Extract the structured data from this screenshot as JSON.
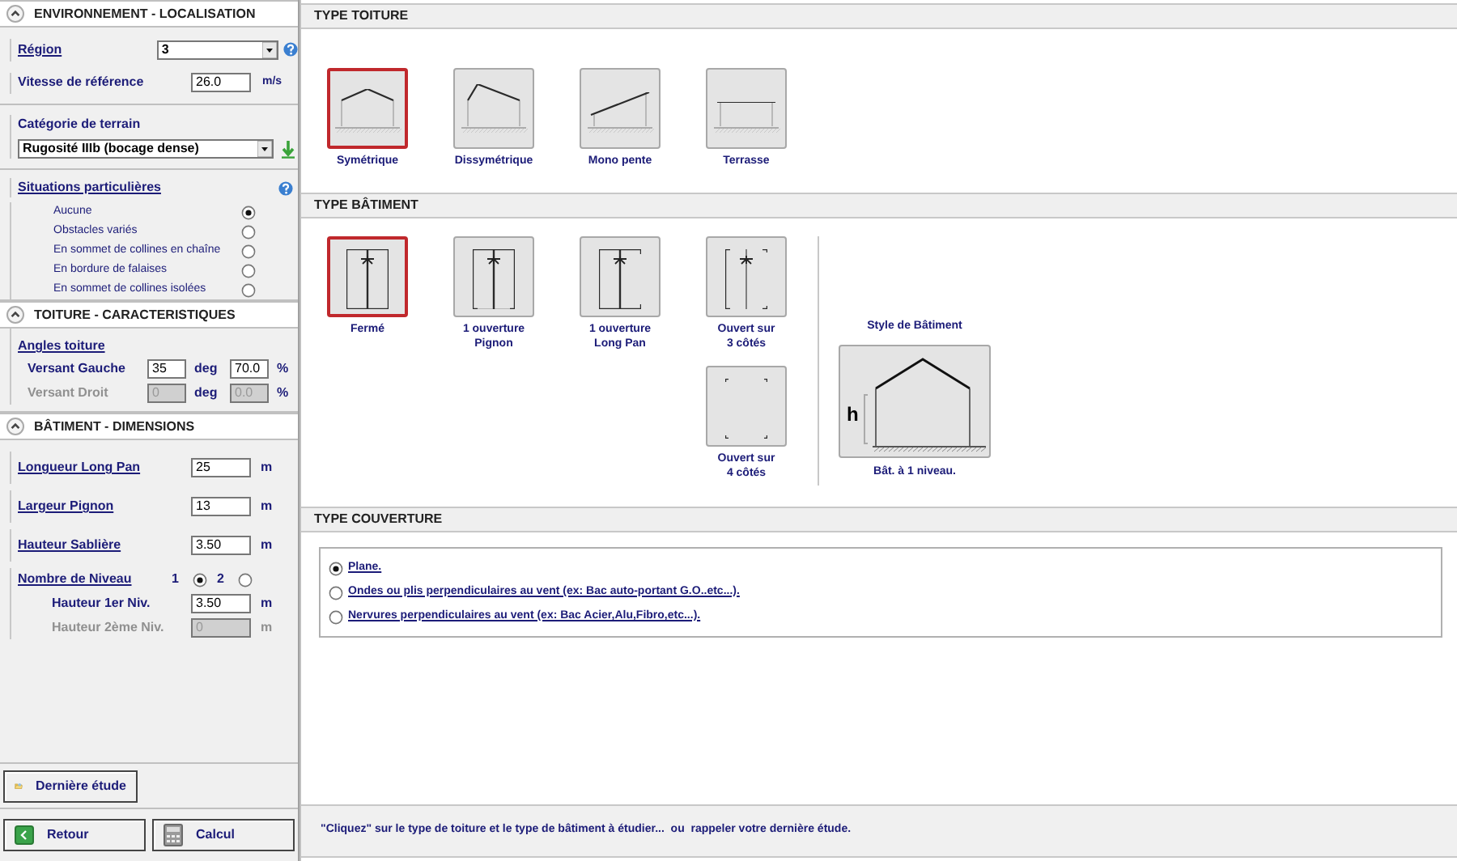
{
  "environnement": {
    "title": "ENVIRONNEMENT - LOCALISATION",
    "expanded": true,
    "region": {
      "label": "Région",
      "value": "3"
    },
    "vitesse": {
      "label": "Vitesse de référence",
      "value": "26.0",
      "unit": "m/s"
    },
    "terrain": {
      "label": "Catégorie de terrain",
      "value": "Rugosité IIIb (bocage dense)"
    },
    "situations": {
      "label": "Situations particulières",
      "options": [
        {
          "label": "Aucune",
          "selected": true
        },
        {
          "label": "Obstacles variés",
          "selected": false
        },
        {
          "label": "En sommet de collines en chaîne",
          "selected": false
        },
        {
          "label": "En bordure de falaises",
          "selected": false
        },
        {
          "label": "En sommet de collines isolées",
          "selected": false
        }
      ]
    }
  },
  "toiture": {
    "title": "TOITURE - CARACTERISTIQUES",
    "expanded": true,
    "angles_label": "Angles toiture",
    "rows": [
      {
        "label": "Versant Gauche",
        "deg": "35",
        "deg_unit": "deg",
        "pct": "70.0",
        "pct_unit": "%",
        "disabled": false
      },
      {
        "label": "Versant Droit",
        "deg": "0",
        "deg_unit": "deg",
        "pct": "0.0",
        "pct_unit": "%",
        "disabled": true
      }
    ]
  },
  "batiment": {
    "title": "BÂTIMENT - DIMENSIONS",
    "expanded": true,
    "fields": [
      {
        "label": "Longueur Long Pan",
        "value": "25",
        "unit": "m"
      },
      {
        "label": "Largeur Pignon",
        "value": "13",
        "unit": "m"
      },
      {
        "label": "Hauteur Sablière",
        "value": "3.50",
        "unit": "m"
      }
    ],
    "niveaux": {
      "label": "Nombre de Niveau",
      "options": [
        {
          "label": "1",
          "selected": true
        },
        {
          "label": "2",
          "selected": false
        }
      ]
    },
    "hauteurs": [
      {
        "label": "Hauteur 1er Niv.",
        "value": "3.50",
        "unit": "m",
        "disabled": false
      },
      {
        "label": "Hauteur 2ème Niv.",
        "value": "0",
        "unit": "m",
        "disabled": true
      }
    ]
  },
  "buttons": [
    {
      "kind": "derniere",
      "label": "Dernière étude"
    },
    {
      "kind": "retour",
      "label": "Retour"
    },
    {
      "kind": "calcul",
      "label": "Calcul"
    }
  ],
  "type_toiture": {
    "title": "TYPE TOITURE",
    "options": [
      {
        "kind": "symetrique",
        "label": "Symétrique",
        "selected": true
      },
      {
        "kind": "dissymetrique",
        "label": "Dissymétrique",
        "selected": false
      },
      {
        "kind": "mono",
        "label": "Mono pente",
        "selected": false
      },
      {
        "kind": "terrasse",
        "label": "Terrasse",
        "selected": false
      }
    ]
  },
  "type_batiment": {
    "title": "TYPE BÂTIMENT",
    "options": [
      {
        "kind": "ferme",
        "label": "Fermé",
        "selected": true
      },
      {
        "kind": "pignon",
        "label": "1 ouverture\nPignon",
        "selected": false
      },
      {
        "kind": "longpan",
        "label": "1 ouverture\nLong Pan",
        "selected": false
      },
      {
        "kind": "trois",
        "label": "Ouvert sur\n3 côtés",
        "selected": false
      },
      {
        "kind": "quatre",
        "label": "Ouvert sur\n4 côtés",
        "selected": false
      }
    ],
    "style": {
      "title": "Style de Bâtiment",
      "height_label": "h",
      "caption": "Bât. à 1 niveau."
    }
  },
  "type_couverture": {
    "title": "TYPE COUVERTURE",
    "options": [
      {
        "label": "Plane.",
        "selected": true
      },
      {
        "label": "Ondes ou plis perpendiculaires au vent (ex: Bac auto-portant G.O..etc...).",
        "selected": false
      },
      {
        "label": "Nervures perpendiculaires au vent (ex: Bac Acier,Alu,Fibro,etc...).",
        "selected": false
      }
    ]
  },
  "status": "\"Cliquez\" sur le type de toiture et le type de bâtiment à étudier...  ou  rappeler votre dernière étude."
}
